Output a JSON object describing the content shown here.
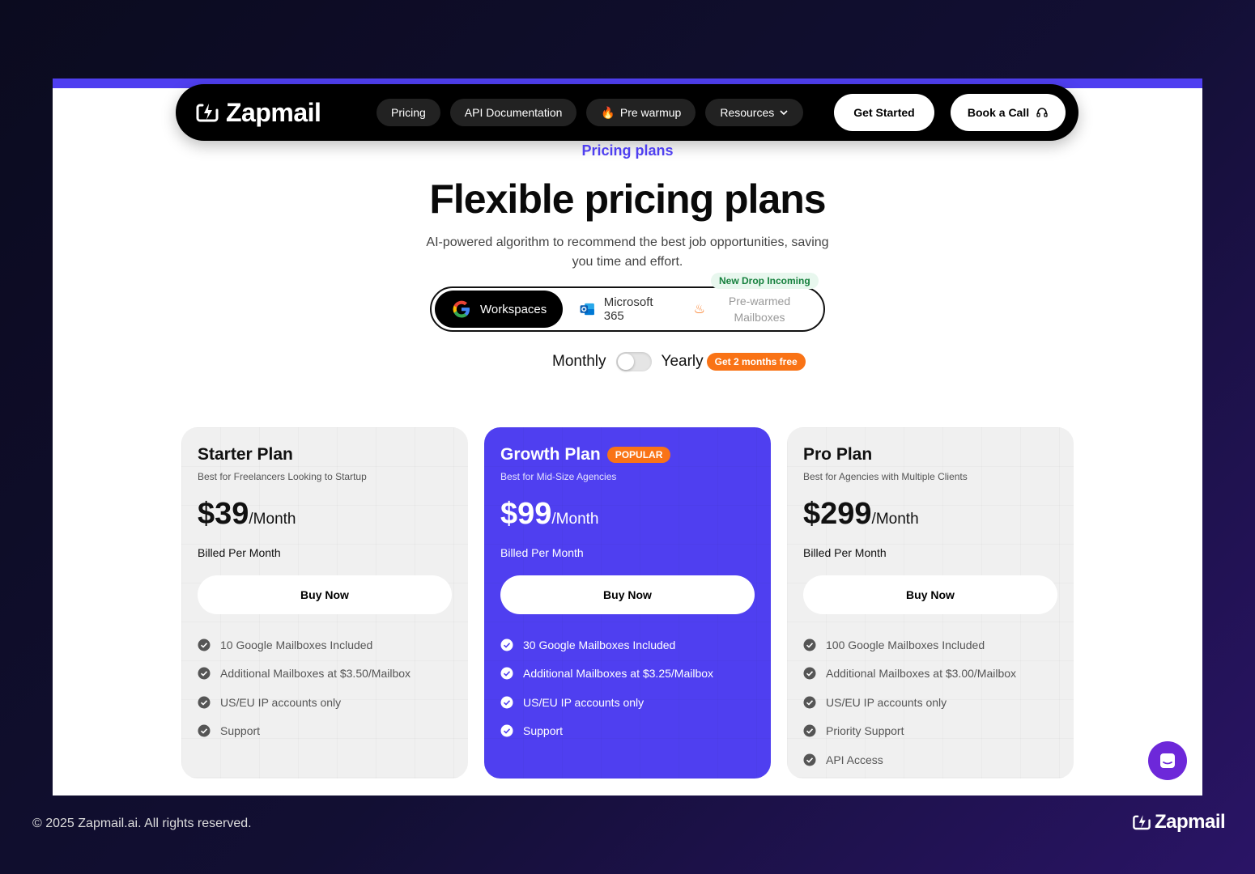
{
  "brand": {
    "name": "Zapmail"
  },
  "nav": {
    "links": [
      "Pricing",
      "API Documentation",
      "Pre warmup",
      "Resources"
    ],
    "get_started": "Get Started",
    "book_call": "Book a Call"
  },
  "hero": {
    "eyebrow": "Pricing plans",
    "title": "Flexible pricing plans",
    "subtitle": "AI-powered algorithm to recommend the best job opportunities, saving you time and effort."
  },
  "tabs": {
    "items": [
      "Workspaces",
      "Microsoft 365",
      "Pre-warmed Mailboxes"
    ],
    "active": "Workspaces",
    "badge": "New Drop Incoming"
  },
  "billing": {
    "monthly": "Monthly",
    "yearly": "Yearly",
    "promo": "Get 2 months free",
    "yearly_selected": false
  },
  "plans": [
    {
      "name": "Starter Plan",
      "desc": "Best for Freelancers Looking to Startup",
      "price": "$39",
      "per": "/Month",
      "billed": "Billed Per Month",
      "cta": "Buy Now",
      "features": [
        "10 Google Mailboxes Included",
        "Additional Mailboxes at $3.50/Mailbox",
        "US/EU IP accounts only",
        "Support"
      ]
    },
    {
      "name": "Growth Plan",
      "badge": "POPULAR",
      "desc": "Best for Mid-Size Agencies",
      "price": "$99",
      "per": "/Month",
      "billed": "Billed Per Month",
      "cta": "Buy Now",
      "features": [
        "30 Google Mailboxes Included",
        "Additional Mailboxes at $3.25/Mailbox",
        "US/EU IP accounts only",
        "Support"
      ]
    },
    {
      "name": "Pro Plan",
      "desc": "Best for Agencies with Multiple Clients",
      "price": "$299",
      "per": "/Month",
      "billed": "Billed Per Month",
      "cta": "Buy Now",
      "features": [
        "100 Google Mailboxes Included",
        "Additional Mailboxes at $3.00/Mailbox",
        "US/EU IP accounts only",
        "Priority Support",
        "API Access"
      ]
    }
  ],
  "footer": {
    "copyright": "© 2025 Zapmail.ai. All rights reserved.",
    "brand": "Zapmail"
  },
  "colors": {
    "accent": "#4f3ff0",
    "orange": "#f97316",
    "navbar": "#000000"
  }
}
